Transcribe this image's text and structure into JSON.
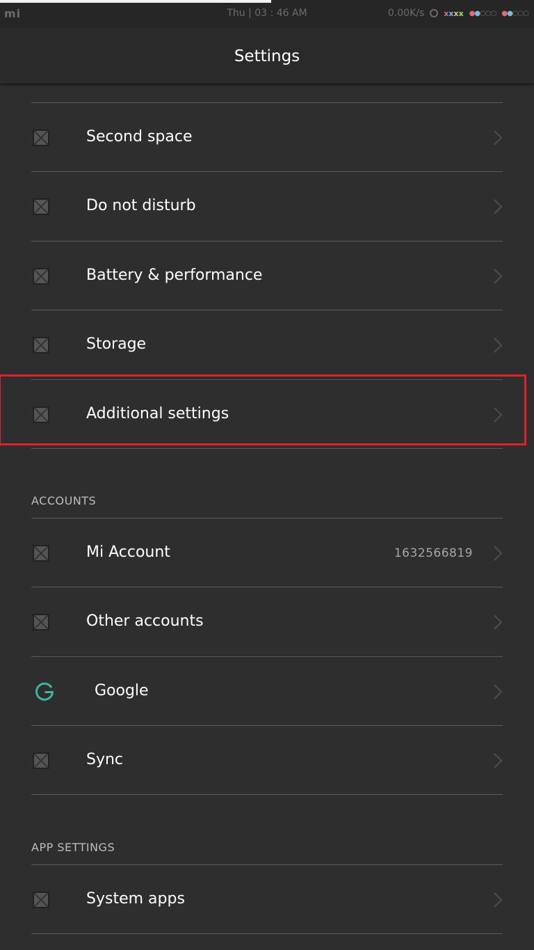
{
  "status_bar": {
    "logo": "mi",
    "center": "Thu | 03 : 46 AM",
    "net_speed": "0.00K/s",
    "signal_marks": "xxxx",
    "sim1_dots": "●●○○○",
    "sim2_dots": "●●○○○"
  },
  "header": {
    "title": "Settings"
  },
  "items_top": [
    {
      "label": "Second space",
      "icon": "square-icon"
    },
    {
      "label": "Do not disturb",
      "icon": "square-icon"
    },
    {
      "label": "Battery & performance",
      "icon": "square-icon"
    },
    {
      "label": "Storage",
      "icon": "square-icon"
    },
    {
      "label": "Additional settings",
      "icon": "square-icon"
    }
  ],
  "accounts_section": {
    "title": "ACCOUNTS",
    "items": [
      {
        "label": "Mi Account",
        "value": "1632566819",
        "icon": "square-icon"
      },
      {
        "label": "Other accounts",
        "icon": "square-icon"
      },
      {
        "label": "Google",
        "icon": "google-g-icon"
      },
      {
        "label": "Sync",
        "icon": "square-icon"
      }
    ]
  },
  "app_settings_section": {
    "title": "APP SETTINGS",
    "items": [
      {
        "label": "System apps",
        "icon": "square-icon"
      }
    ]
  },
  "colors": {
    "background": "#2e2e2e",
    "highlight": "#e1202a",
    "google_icon": "#3cb5a3"
  }
}
